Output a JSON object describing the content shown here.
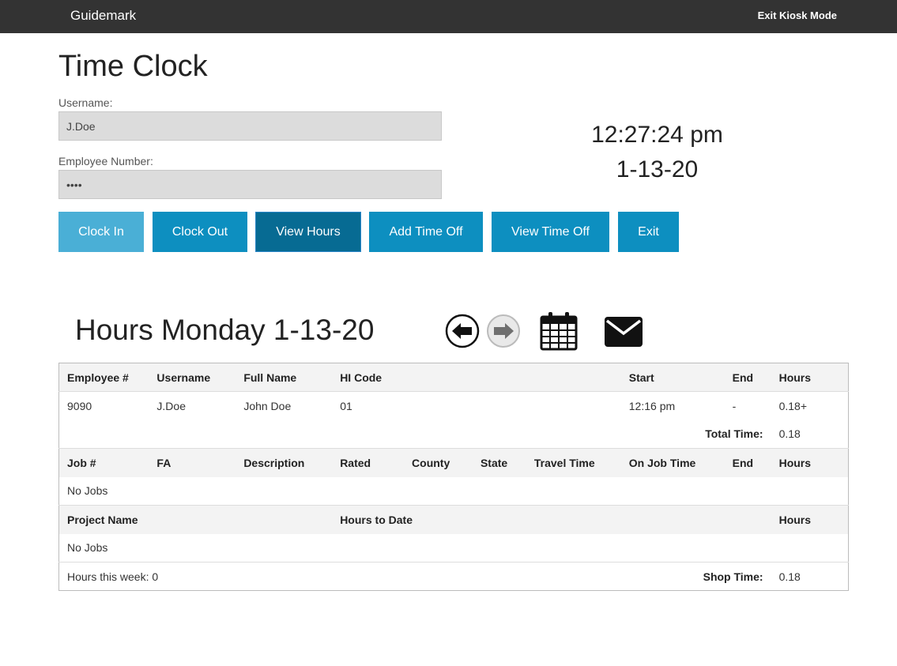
{
  "navbar": {
    "brand": "Guidemark",
    "kiosk_link": "Exit Kiosk Mode"
  },
  "page_title": "Time Clock",
  "form": {
    "username_label": "Username:",
    "username_value": "J.Doe",
    "employee_label": "Employee Number:",
    "employee_value": "9090"
  },
  "clock": {
    "time": "12:27:24 pm",
    "date": "1-13-20"
  },
  "buttons": {
    "clock_in": "Clock In",
    "clock_out": "Clock Out",
    "view_hours": "View Hours",
    "add_time_off": "Add Time Off",
    "view_time_off": "View Time Off",
    "exit": "Exit"
  },
  "hours": {
    "title": "Hours Monday 1-13-20",
    "icons": [
      "arrow-left-icon",
      "arrow-right-icon",
      "calendar-icon",
      "envelope-icon"
    ],
    "shift_headers": {
      "employee": "Employee #",
      "username": "Username",
      "full_name": "Full Name",
      "hi_code": "HI Code",
      "start": "Start",
      "end": "End",
      "hours": "Hours"
    },
    "shift": {
      "employee": "9090",
      "username": "J.Doe",
      "full_name": "John Doe",
      "hi_code": "01",
      "start": "12:16 pm",
      "end": "-",
      "hours": "0.18+"
    },
    "total_label": "Total Time:",
    "total_value": "0.18",
    "job_headers": {
      "job": "Job #",
      "fa": "FA",
      "description": "Description",
      "rated": "Rated",
      "county": "County",
      "state": "State",
      "travel_time": "Travel Time",
      "on_job_time": "On Job Time",
      "end": "End",
      "hours": "Hours"
    },
    "no_jobs": "No Jobs",
    "project_headers": {
      "project_name": "Project Name",
      "hours_to_date": "Hours to Date",
      "hours": "Hours"
    },
    "no_projects": "No Jobs",
    "week_label": "Hours this week: 0",
    "shop_label": "Shop Time:",
    "shop_value": "0.18"
  },
  "colors": {
    "navbar": "#333333",
    "button": "#0d8fc0",
    "button_light": "#4aafd6",
    "button_active": "#076b93",
    "input_bg": "#dcdcdc",
    "table_header": "#f3f3f3"
  }
}
